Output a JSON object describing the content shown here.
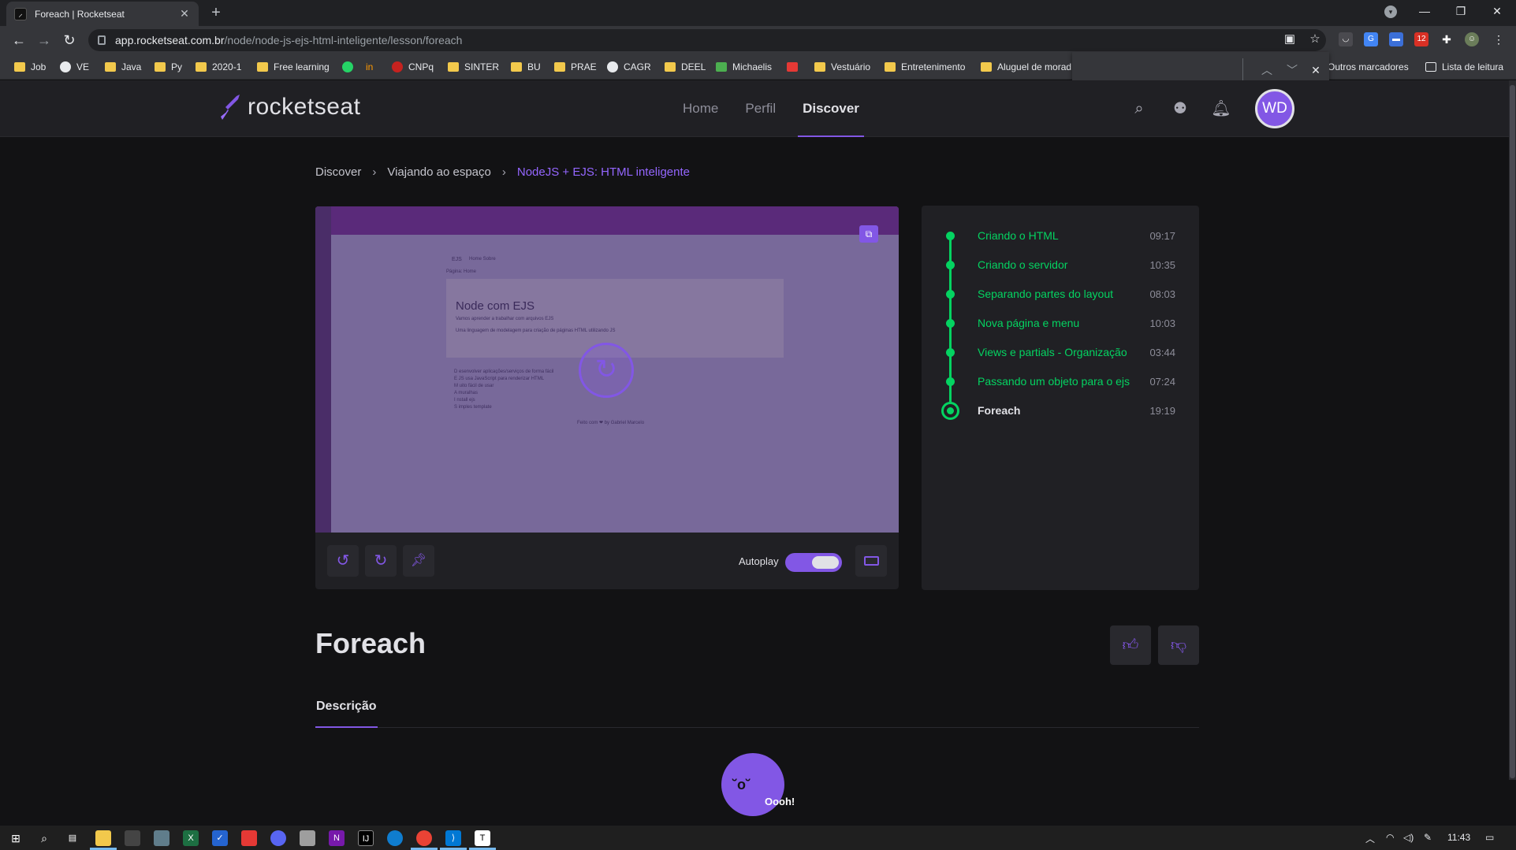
{
  "browser": {
    "tab_title": "Foreach | Rocketseat",
    "tab_favicon": "rocketseat-favicon",
    "new_tab": "+",
    "url_host": "app.rocketseat.com.br",
    "url_path": "/node/node-js-ejs-html-inteligente/lesson/foreach",
    "window_controls": {
      "minimize": "—",
      "restore": "❐",
      "close": "✕"
    },
    "extension_badge": "12"
  },
  "bookmarks": [
    {
      "label": "Job",
      "icon": "folder"
    },
    {
      "label": "VE",
      "icon": "site"
    },
    {
      "label": "Java",
      "icon": "folder"
    },
    {
      "label": "Py",
      "icon": "folder"
    },
    {
      "label": "2020-1",
      "icon": "folder"
    },
    {
      "label": "Free learning",
      "icon": "folder"
    },
    {
      "label": "",
      "icon": "whatsapp"
    },
    {
      "label": "in",
      "icon": "site"
    },
    {
      "label": "CNPq",
      "icon": "site"
    },
    {
      "label": "SINTER",
      "icon": "folder"
    },
    {
      "label": "BU",
      "icon": "folder"
    },
    {
      "label": "PRAE",
      "icon": "folder"
    },
    {
      "label": "CAGR",
      "icon": "site"
    },
    {
      "label": "DEEL",
      "icon": "folder"
    },
    {
      "label": "Michaelis",
      "icon": "site"
    },
    {
      "label": "",
      "icon": "site-s"
    },
    {
      "label": "Vestuário",
      "icon": "folder"
    },
    {
      "label": "Entretenimento",
      "icon": "folder"
    },
    {
      "label": "Aluguel de morad",
      "icon": "folder"
    }
  ],
  "bookmarks_right": {
    "other": "Outros marcadores",
    "reading_list": "Lista de leitura"
  },
  "header": {
    "logo": "rocketseat",
    "nav": [
      "Home",
      "Perfil",
      "Discover"
    ],
    "active_nav": "Discover",
    "avatar_initials": "WD"
  },
  "breadcrumb": [
    "Discover",
    "Viajando ao espaço",
    "NodeJS + EJS: HTML inteligente"
  ],
  "video": {
    "heading": "Node com EJS",
    "sub1": "Vamos aprender a trabalhar com arquivos EJS",
    "sub2": "Uma linguagem de modelagem para criação de páginas HTML utilizando JS",
    "nav_title": "EJS",
    "nav_links": "Home   Sobre",
    "page_label": "Página: Home",
    "list": [
      "D esenvolver aplicações/serviços de forma fácil",
      "E JS usa JavaScript para renderizar HTML",
      "M uito fácil de usar",
      "A muralhas",
      "I nstall ejs",
      "S imples template"
    ],
    "footer": "Feito com ❤ by Gabriel Marcelo"
  },
  "player_controls": {
    "autoplay_label": "Autoplay",
    "autoplay_on": true
  },
  "lessons": [
    {
      "title": "Criando o HTML",
      "duration": "09:17",
      "current": false
    },
    {
      "title": "Criando o servidor",
      "duration": "10:35",
      "current": false
    },
    {
      "title": "Separando partes do layout",
      "duration": "08:03",
      "current": false
    },
    {
      "title": "Nova página e menu",
      "duration": "10:03",
      "current": false
    },
    {
      "title": "Views e partials - Organização",
      "duration": "03:44",
      "current": false
    },
    {
      "title": "Passando um objeto para o ejs",
      "duration": "07:24",
      "current": false
    },
    {
      "title": "Foreach",
      "duration": "19:19",
      "current": true
    }
  ],
  "lesson": {
    "title": "Foreach",
    "tab": "Descrição",
    "empty_message": "Oooh!"
  },
  "taskbar": {
    "time": "11:43"
  },
  "colors": {
    "brand": "#8257e5",
    "success": "#04d361",
    "bg": "#121214",
    "panel": "#202024"
  }
}
